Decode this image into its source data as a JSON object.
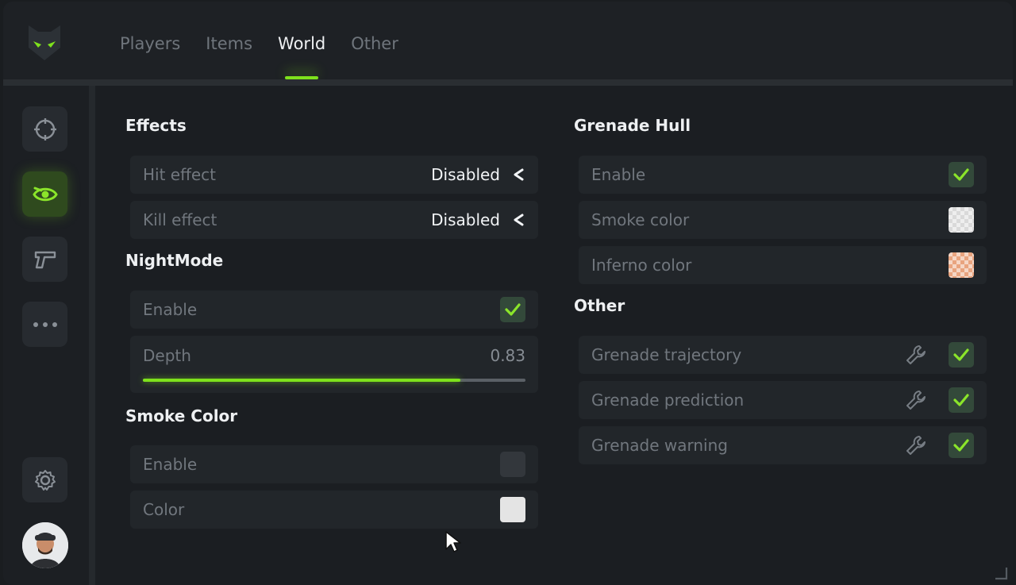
{
  "accent": "#7ee21c",
  "nav": {
    "tabs": [
      {
        "label": "Players"
      },
      {
        "label": "Items"
      },
      {
        "label": "World",
        "active": true
      },
      {
        "label": "Other"
      }
    ]
  },
  "sidebar": {
    "items": [
      {
        "icon": "crosshair-icon"
      },
      {
        "icon": "eye-icon",
        "active": true
      },
      {
        "icon": "pistol-icon"
      },
      {
        "icon": "more-dots-icon"
      }
    ],
    "bottom": [
      {
        "icon": "settings-gear-icon"
      },
      {
        "icon": "avatar"
      }
    ]
  },
  "effects": {
    "title": "Effects",
    "hit": {
      "label": "Hit effect",
      "value": "Disabled"
    },
    "kill": {
      "label": "Kill effect",
      "value": "Disabled"
    }
  },
  "nightmode": {
    "title": "NightMode",
    "enable": {
      "label": "Enable",
      "checked": true
    },
    "depth": {
      "label": "Depth",
      "value": "0.83",
      "fraction": 0.83
    }
  },
  "smoke_color": {
    "title": "Smoke Color",
    "enable": {
      "label": "Enable",
      "checked": false
    },
    "color": {
      "label": "Color",
      "swatch": "#e4e4e4"
    }
  },
  "grenade_hull": {
    "title": "Grenade Hull",
    "enable": {
      "label": "Enable",
      "checked": true
    },
    "smoke": {
      "label": "Smoke color",
      "swatch": "#d9d9d9"
    },
    "inferno": {
      "label": "Inferno color",
      "swatch": "#e9a47f"
    }
  },
  "other": {
    "title": "Other",
    "items": [
      {
        "label": "Grenade trajectory",
        "checked": true
      },
      {
        "label": "Grenade prediction",
        "checked": true
      },
      {
        "label": "Grenade warning",
        "checked": true
      }
    ]
  }
}
